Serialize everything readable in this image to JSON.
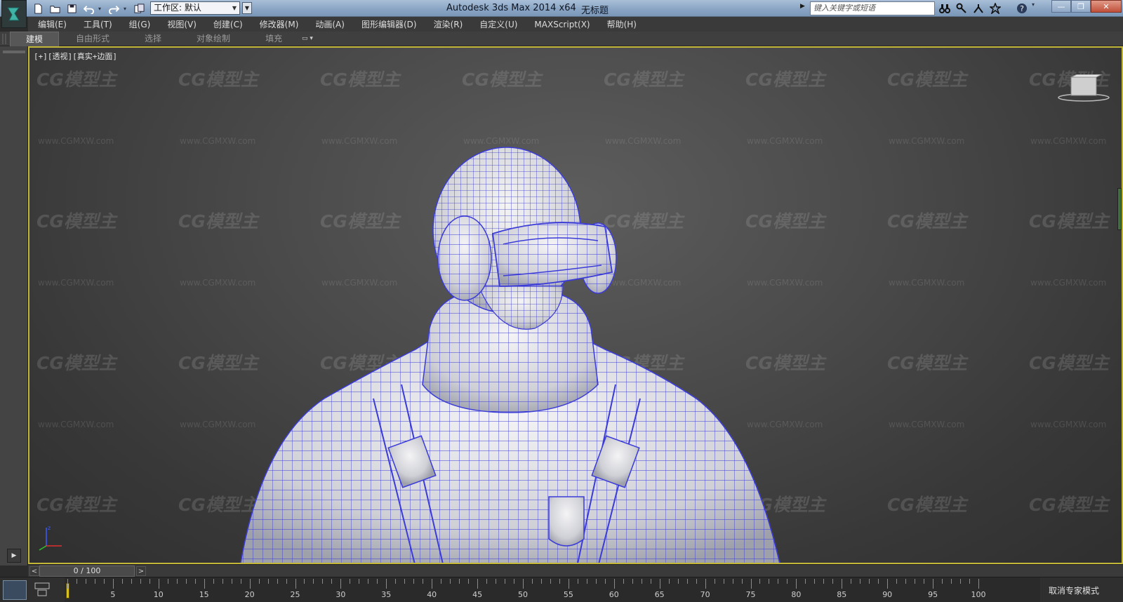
{
  "app": {
    "title": "Autodesk 3ds Max  2014 x64",
    "document": "无标题",
    "workspace_label": "工作区: 默认",
    "search_placeholder": "键入关键字或短语"
  },
  "menu": [
    "编辑(E)",
    "工具(T)",
    "组(G)",
    "视图(V)",
    "创建(C)",
    "修改器(M)",
    "动画(A)",
    "图形编辑器(D)",
    "渲染(R)",
    "自定义(U)",
    "MAXScript(X)",
    "帮助(H)"
  ],
  "ribbon_tabs": [
    "建模",
    "自由形式",
    "选择",
    "对象绘制",
    "填充"
  ],
  "ribbon_active": "建模",
  "viewport": {
    "label": "[+][透视][真实+边面]",
    "watermark_logo": "CG模型主",
    "watermark_url": "www.CGMXW.com"
  },
  "timeline": {
    "frame_display": "0 / 100",
    "ticks": [
      5,
      10,
      15,
      20,
      25,
      30,
      35,
      40,
      45,
      50,
      55,
      60,
      65,
      70,
      75,
      80,
      85,
      90,
      95,
      100
    ],
    "current_frame": 0,
    "total_frames": 100
  },
  "status": {
    "expert_mode": "取消专家模式"
  },
  "colors": {
    "viewport_border": "#c3b73a",
    "wireframe": "#3b3bd8",
    "titlebar": "#8aa5c4"
  }
}
